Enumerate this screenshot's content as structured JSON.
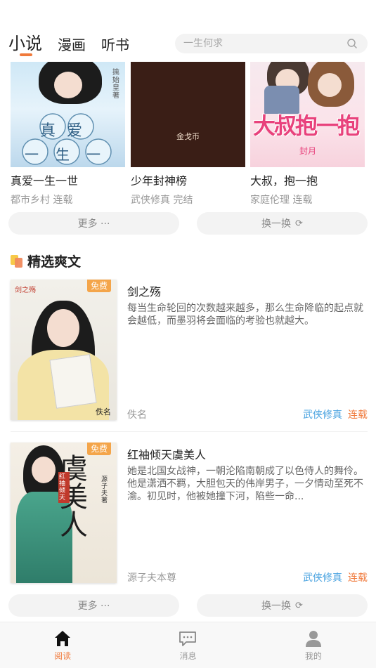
{
  "header": {
    "tabs": [
      {
        "label": "小说",
        "active": true
      },
      {
        "label": "漫画",
        "active": false
      },
      {
        "label": "听书",
        "active": false
      }
    ],
    "search": {
      "placeholder": "一生何求"
    },
    "accent_color": "#f07a3c"
  },
  "top_books": [
    {
      "title": "真爱一生一世",
      "category": "都市乡村",
      "status": "连载",
      "cover_text": "真爱一生一世",
      "cover_author": "擒始皇 著"
    },
    {
      "title": "少年封神榜",
      "category": "武侠修真",
      "status": "完结",
      "cover_text": "金戈币"
    },
    {
      "title": "大叔，抱一抱",
      "category": "家庭伦理",
      "status": "连载",
      "cover_text": "大叔抱一抱",
      "cover_author": "封月"
    }
  ],
  "top_buttons": {
    "more": "更多 ···",
    "refresh": "换一换"
  },
  "section": {
    "title": "精选爽文"
  },
  "featured": [
    {
      "badge": "免费",
      "title": "剑之殇",
      "description": "每当生命轮回的次数越来越多，那么生命降临的起点就会越低，而墨羽将会面临的考验也就越大。",
      "author": "佚名",
      "genre": "武侠修真",
      "status": "连载",
      "cover_text": "剑之殇",
      "cover_author": "佚名"
    },
    {
      "badge": "免费",
      "title": "红袖倾天虞美人",
      "description": "她是北国女战神，一朝沦陷南朝成了以色侍人的舞伶。他是潇洒不羁，大胆包天的伟岸男子，一夕情动至死不渝。初见时，他被她撞下河，陷些一命...",
      "author": "源子夫本尊",
      "genre": "武侠修真",
      "status": "连载",
      "cover_text": "虞美人",
      "cover_subtext": "红袖倾天",
      "cover_author": "源子夫 著"
    }
  ],
  "bottom_buttons": {
    "more": "更多 ···",
    "refresh": "换一换"
  },
  "bottom_nav": [
    {
      "label": "阅读",
      "icon": "home-icon",
      "active": true
    },
    {
      "label": "消息",
      "icon": "message-icon",
      "active": false
    },
    {
      "label": "我的",
      "icon": "profile-icon",
      "active": false
    }
  ]
}
